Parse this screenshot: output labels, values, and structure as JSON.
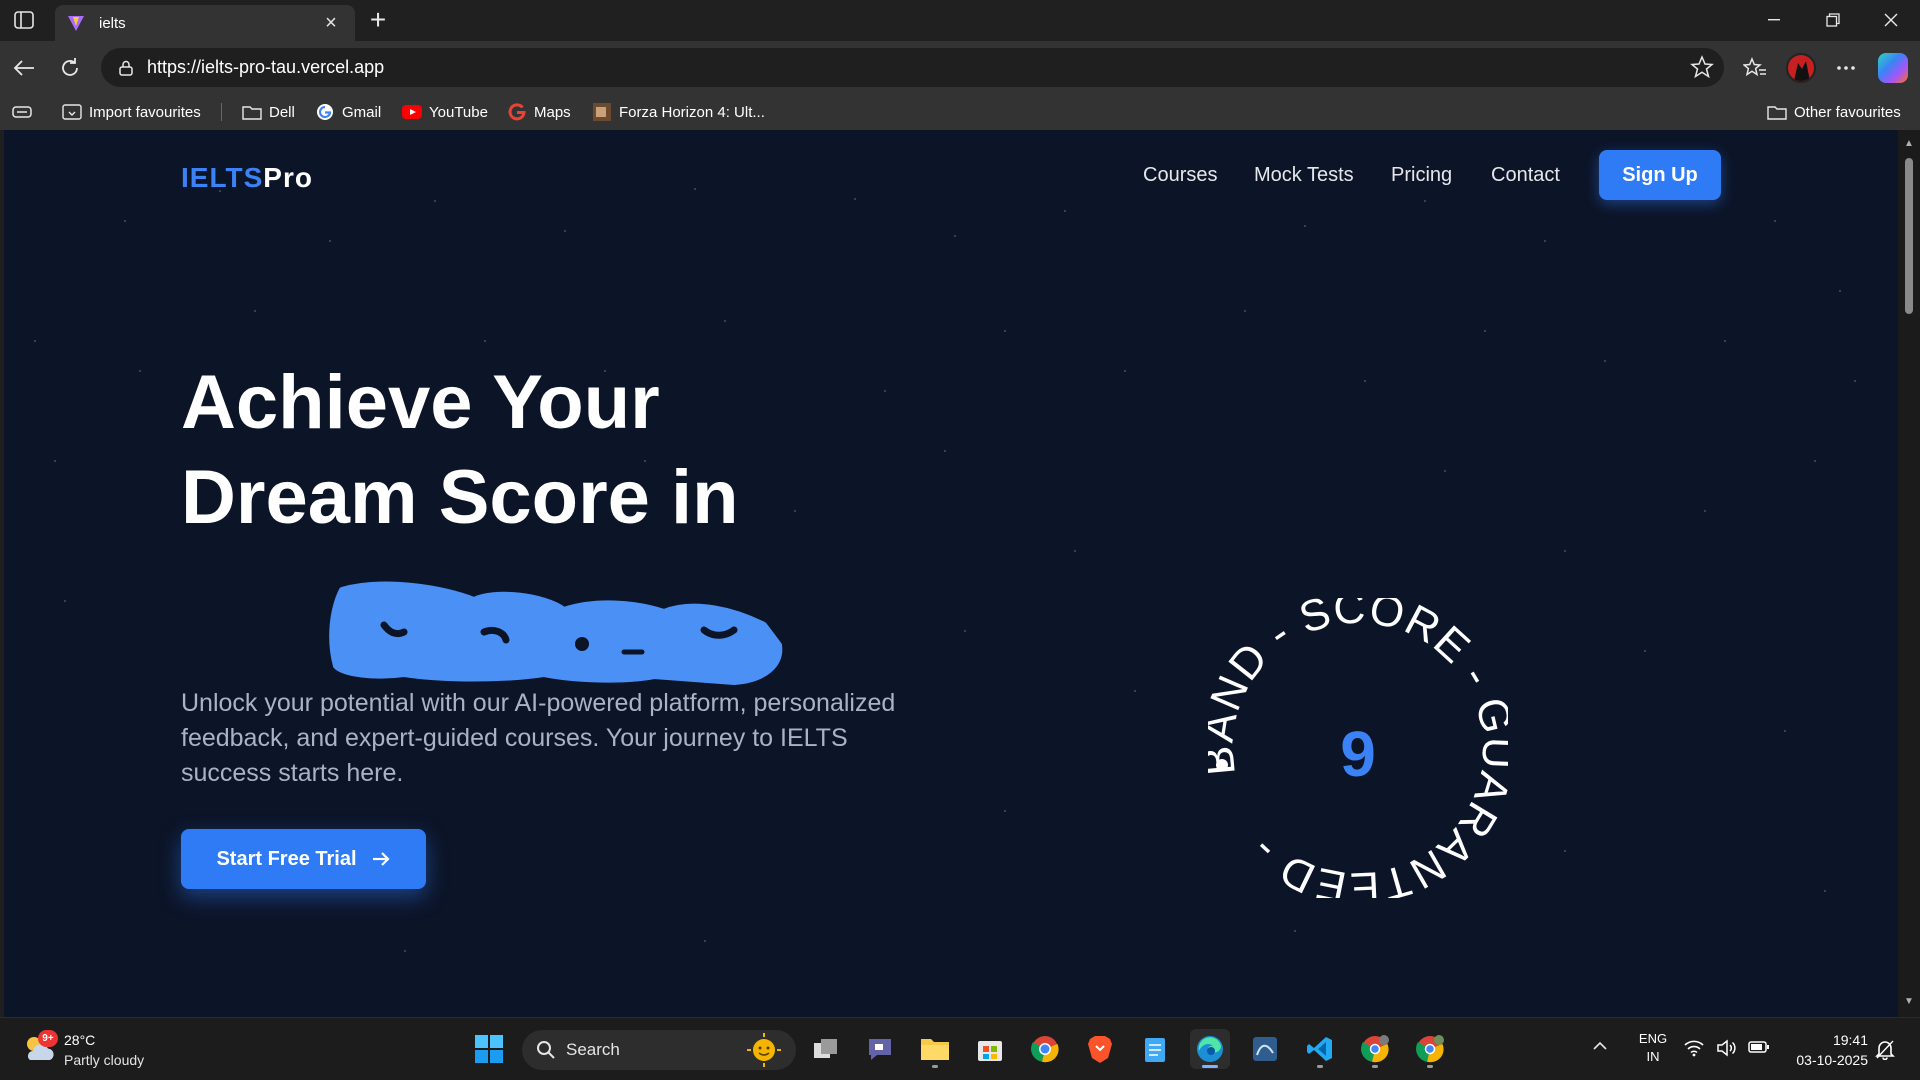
{
  "browser": {
    "tab_title": "ielts",
    "url": "https://ielts-pro-tau.vercel.app",
    "favourites": [
      "Import favourites",
      "Dell",
      "Gmail",
      "YouTube",
      "Maps",
      "Forza Horizon 4: Ult..."
    ],
    "other_favourites": "Other favourites"
  },
  "site": {
    "logo_part1": "IELTS",
    "logo_part2": "Pro",
    "nav": [
      "Courses",
      "Mock Tests",
      "Pricing",
      "Contact"
    ],
    "signup_label": "Sign Up",
    "headline_line1": "Achieve Your",
    "headline_line2": "Dream Score in",
    "subtext": "Unlock your potential with our AI-powered platform, personalized feedback, and expert-guided courses. Your journey to IELTS success starts here.",
    "cta_label": "Start Free Trial",
    "badge_ring_text": "BAND - SCORE - GUARANTEED - ",
    "badge_score": "9"
  },
  "taskbar": {
    "weather_temp": "28°C",
    "weather_desc": "Partly cloudy",
    "weather_badge": "9+",
    "search_label": "Search",
    "lang_line1": "ENG",
    "lang_line2": "IN",
    "time": "19:41",
    "date": "03-10-2025"
  },
  "colors": {
    "page_background": "#0c1427",
    "accent_blue": "#2f7bf5",
    "logo_blue": "#3b82f6",
    "scribble_blue": "#4a90f5"
  },
  "icons": [
    "sidebar-toggle-icon",
    "vite-favicon-icon",
    "close-icon",
    "plus-icon",
    "minimize-icon",
    "restore-icon",
    "window-close-icon",
    "back-icon",
    "refresh-icon",
    "site-info-icon",
    "star-icon",
    "favourites-icon",
    "more-icon",
    "copilot-icon",
    "collections-icon",
    "folder-icon",
    "google-icon",
    "youtube-icon",
    "arrow-right-icon",
    "windows-start-icon",
    "search-icon",
    "wifi-icon",
    "volume-icon",
    "battery-icon",
    "bell-icon"
  ]
}
